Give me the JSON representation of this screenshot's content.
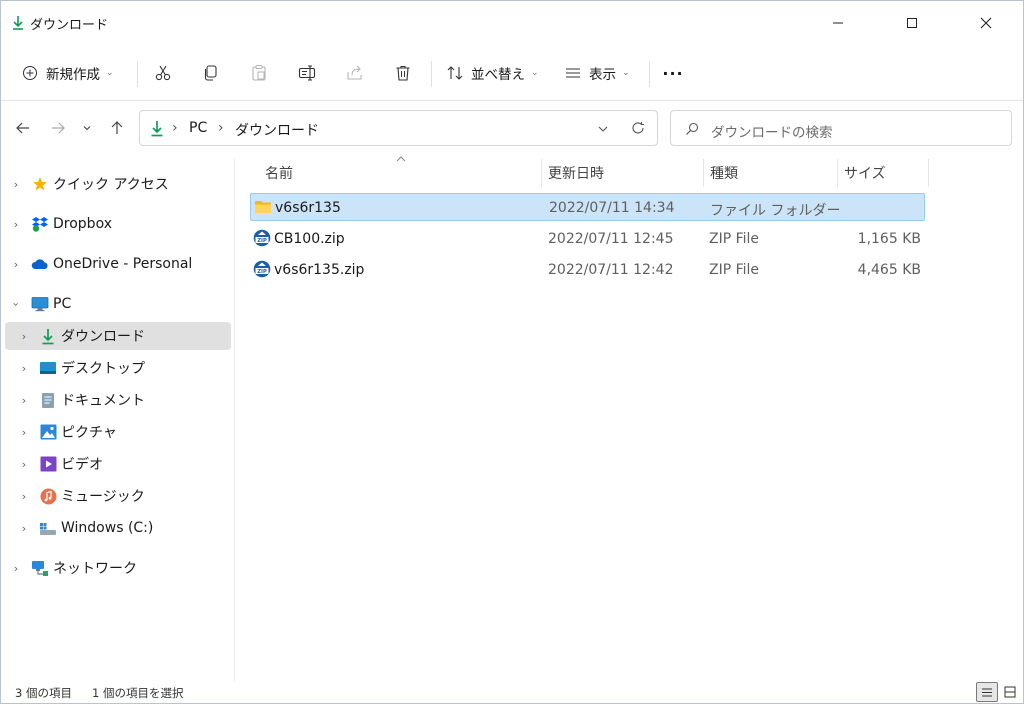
{
  "window": {
    "title": "ダウンロード",
    "accent_color": "#0f9d58",
    "selection_color": "#cce4f7"
  },
  "toolbar": {
    "new_label": "新規作成",
    "sort_label": "並べ替え",
    "view_label": "表示",
    "more_label": "···",
    "icons": [
      "cut-icon",
      "copy-icon",
      "paste-icon",
      "rename-icon",
      "share-icon",
      "delete-icon"
    ]
  },
  "address": {
    "segments": [
      "PC",
      "ダウンロード"
    ],
    "separator": "›"
  },
  "search": {
    "placeholder": "ダウンロードの検索"
  },
  "sidebar": {
    "items": [
      {
        "label": "クイック アクセス",
        "icon": "star-icon"
      },
      {
        "label": "Dropbox",
        "icon": "dropbox-icon"
      },
      {
        "label": "OneDrive - Personal",
        "icon": "cloud-icon"
      },
      {
        "label": "PC",
        "icon": "monitor-icon"
      },
      {
        "label": "ダウンロード",
        "icon": "download-icon"
      },
      {
        "label": "デスクトップ",
        "icon": "desktop-icon"
      },
      {
        "label": "ドキュメント",
        "icon": "document-icon"
      },
      {
        "label": "ピクチャ",
        "icon": "pictures-icon"
      },
      {
        "label": "ビデオ",
        "icon": "video-icon"
      },
      {
        "label": "ミュージック",
        "icon": "music-icon"
      },
      {
        "label": "Windows (C:)",
        "icon": "drive-icon"
      },
      {
        "label": "ネットワーク",
        "icon": "network-icon"
      }
    ]
  },
  "columns": {
    "name": "名前",
    "date": "更新日時",
    "type": "種類",
    "size": "サイズ"
  },
  "files": [
    {
      "name": "v6s6r135",
      "date": "2022/07/11 14:34",
      "type": "ファイル フォルダー",
      "size": "",
      "icon": "folder-icon"
    },
    {
      "name": "CB100.zip",
      "date": "2022/07/11 12:45",
      "type": "ZIP File",
      "size": "1,165 KB",
      "icon": "zip-icon"
    },
    {
      "name": "v6s6r135.zip",
      "date": "2022/07/11 12:42",
      "type": "ZIP File",
      "size": "4,465 KB",
      "icon": "zip-icon"
    }
  ],
  "status": {
    "item_count": "3 個の項目",
    "selected": "1 個の項目を選択"
  }
}
